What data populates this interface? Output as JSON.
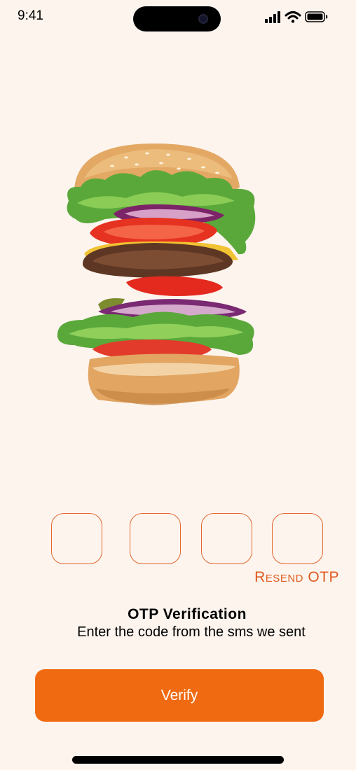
{
  "status_bar": {
    "time": "9:41",
    "icons": [
      "signal-icon",
      "wifi-icon",
      "battery-icon"
    ]
  },
  "hero": {
    "image": "burger-image"
  },
  "otp": {
    "digits": [
      "",
      "",
      "",
      ""
    ],
    "resend_label": "Resend OTP"
  },
  "heading": {
    "title": "OTP Verification",
    "subtitle": "Enter the code from the sms we sent"
  },
  "actions": {
    "verify_label": "Verify"
  },
  "colors": {
    "background": "#fdf4ee",
    "accent": "#f06a12",
    "box_border": "#e2672e",
    "resend_text": "#e05a1c"
  }
}
